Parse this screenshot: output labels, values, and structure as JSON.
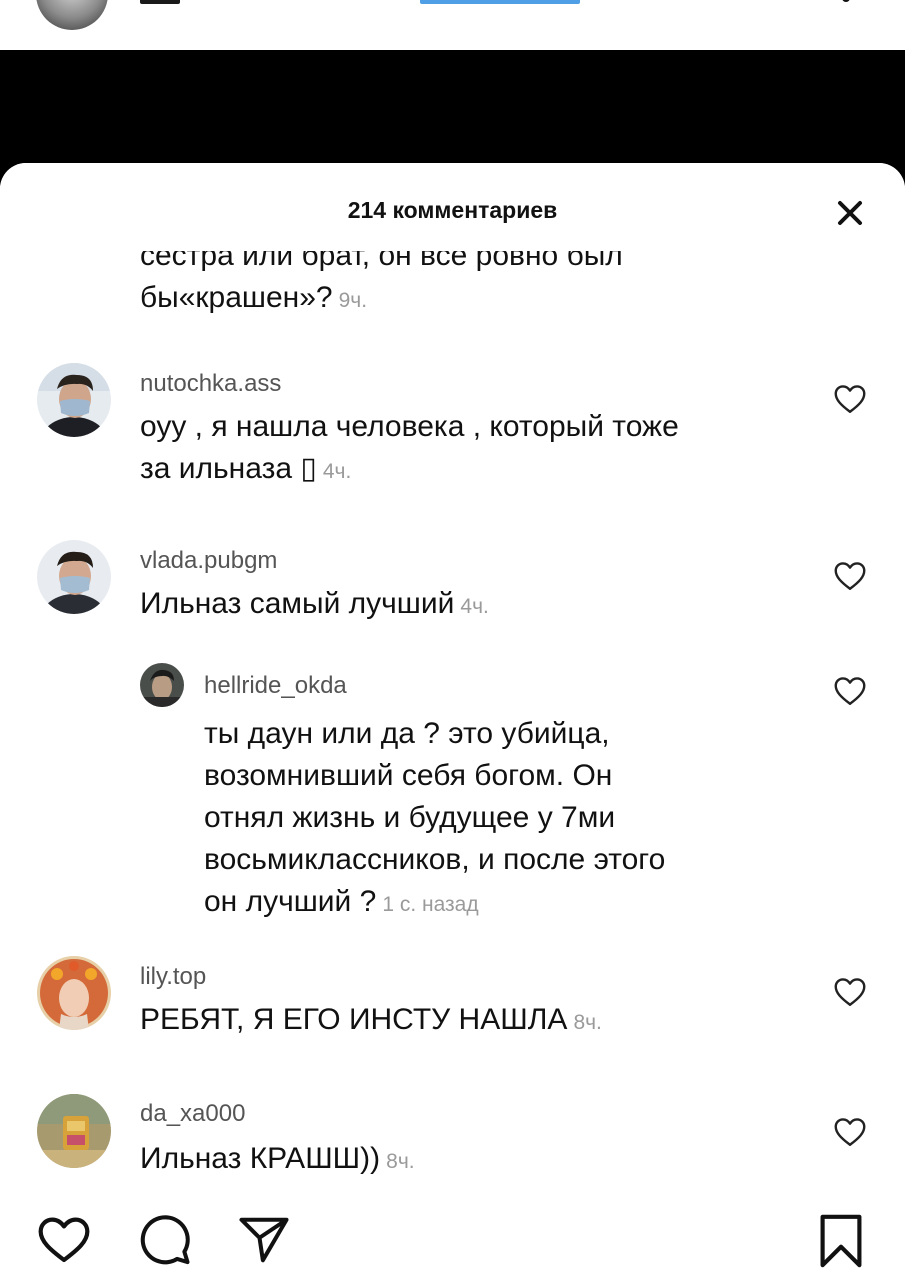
{
  "sheet": {
    "title": "214 комментариев",
    "close_icon": "close-icon"
  },
  "partial_comment": {
    "line1": "сестра или брат, он все ровно был",
    "line2": "бы«крашен»?",
    "time": "9ч."
  },
  "comments": [
    {
      "username": "nutochka.ass",
      "text_line1": "оуу , я нашла человека , который тоже",
      "text_line2": "за ильназа ▯",
      "time": "4ч.",
      "like_icon": "heart-outline-icon"
    },
    {
      "username": "vlada.pubgm",
      "text": "Ильназ самый лучший",
      "time": "4ч.",
      "like_icon": "heart-outline-icon"
    },
    {
      "username": "hellride_okda",
      "reply": true,
      "lines": [
        "ты даун или да ? это убийца,",
        "возомнивший себя богом. Он",
        "отнял жизнь и будущее у 7ми",
        "восьмиклассников, и после этого"
      ],
      "last_line": "он лучший ?",
      "time": "1 с. назад",
      "like_icon": "heart-outline-icon"
    },
    {
      "username": "lily.top",
      "text": "РЕБЯТ, Я ЕГО ИНСТУ НАШЛА",
      "time": "8ч.",
      "like_icon": "heart-outline-icon"
    },
    {
      "username": "da_xa000",
      "text": "Ильназ КРАШШ))",
      "time": "8ч.",
      "like_icon": "heart-outline-icon"
    }
  ],
  "bottom_bar": {
    "like_icon": "heart-outline-icon",
    "comment_icon": "comment-bubble-icon",
    "share_icon": "paper-plane-icon",
    "save_icon": "bookmark-icon"
  }
}
